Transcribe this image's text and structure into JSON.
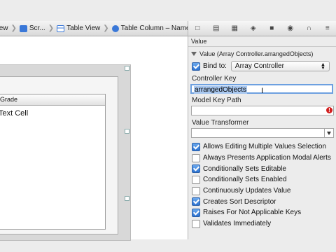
{
  "breadcrumbs": [
    {
      "label": "View",
      "icon": "view-icon",
      "color": "#3a78d8"
    },
    {
      "label": "Scr...",
      "icon": "scroll-view-icon",
      "color": "#3a78d8"
    },
    {
      "label": "Table View",
      "icon": "table-view-icon",
      "color": "#3a78d8"
    },
    {
      "label": "Table Column – Name",
      "icon": "table-column-icon",
      "color": "#3a78d8"
    }
  ],
  "canvas": {
    "column_header": "Grade",
    "cell_text": "Text Cell"
  },
  "inspector": {
    "toolbar_icons": [
      "file-icon",
      "quick-help-icon",
      "identity-icon",
      "attributes-icon",
      "size-icon",
      "connections-icon",
      "bindings-icon",
      "effects-icon"
    ],
    "section_title": "Value",
    "binding_title": "Value (Array Controller.arrangedObjects)",
    "bind_to_label": "Bind to:",
    "bind_to_checked": true,
    "bind_to_value": "Array Controller",
    "controller_key_label": "Controller Key",
    "controller_key_value": "arrangedObjects",
    "model_key_path_label": "Model Key Path",
    "model_key_path_value": "",
    "value_transformer_label": "Value Transformer",
    "value_transformer_value": "",
    "options": [
      {
        "label": "Allows Editing Multiple Values Selection",
        "checked": true
      },
      {
        "label": "Always Presents Application Modal Alerts",
        "checked": false
      },
      {
        "label": "Conditionally Sets Editable",
        "checked": true
      },
      {
        "label": "Conditionally Sets Enabled",
        "checked": false
      },
      {
        "label": "Continuously Updates Value",
        "checked": false
      },
      {
        "label": "Creates Sort Descriptor",
        "checked": true
      },
      {
        "label": "Raises For Not Applicable Keys",
        "checked": true
      },
      {
        "label": "Validates Immediately",
        "checked": false
      }
    ]
  }
}
